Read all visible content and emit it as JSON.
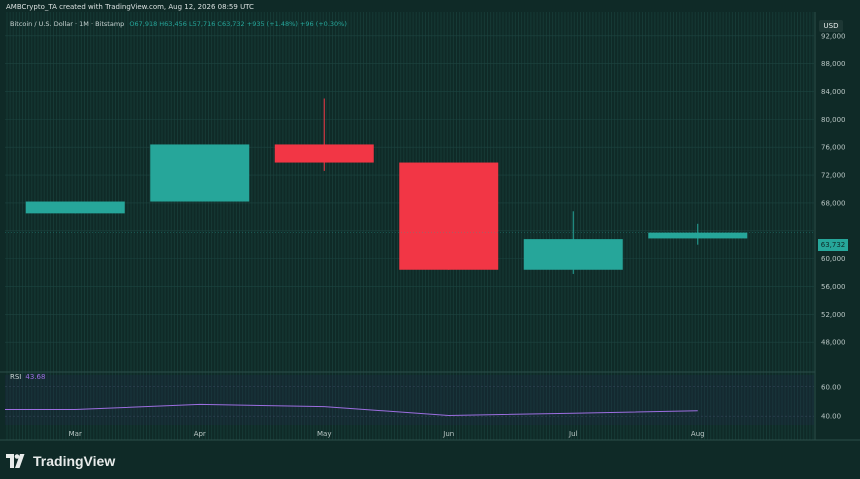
{
  "credit": "AMBCrypto_TA created with TradingView.com, Aug 12, 2026 08:59 UTC",
  "symbol": {
    "name": "Bitcoin / U.S. Dollar · 1M · Bitstamp",
    "ohlc": "O67,918 H63,456 L57,716 C63,732 +935 (+1.48%) +96 (+0.30%)"
  },
  "currency_badge": "USD",
  "last_price_label": "63,732",
  "rsi": {
    "label": "RSI",
    "value": "43.68"
  },
  "brand": "TradingView",
  "colors": {
    "bg": "#0f2a27",
    "up": "#26a69a",
    "down": "#f23645",
    "rsi": "#9c6ee0"
  },
  "chart_data": [
    {
      "type": "candlestick",
      "title": "Bitcoin / U.S. Dollar · 1M · Bitstamp",
      "categories": [
        "Mar",
        "Apr",
        "May",
        "Jun",
        "Jul",
        "Aug"
      ],
      "candles": [
        {
          "x": "Mar",
          "open": 66500,
          "high": 68200,
          "low": 66500,
          "close": 68200
        },
        {
          "x": "Apr",
          "open": 68200,
          "high": 76400,
          "low": 68200,
          "close": 76400
        },
        {
          "x": "May",
          "open": 76400,
          "high": 83000,
          "low": 72600,
          "close": 73800
        },
        {
          "x": "Jun",
          "open": 73800,
          "high": 73800,
          "low": 58400,
          "close": 58400
        },
        {
          "x": "Jul",
          "open": 58400,
          "high": 66800,
          "low": 57800,
          "close": 62800
        },
        {
          "x": "Aug",
          "open": 62900,
          "high": 65000,
          "low": 62000,
          "close": 63732
        }
      ],
      "y_ticks": [
        48000,
        52000,
        56000,
        60000,
        64000,
        68000,
        72000,
        76000,
        80000,
        84000,
        88000,
        92000
      ],
      "y_tick_labels": [
        "48,000",
        "52,000",
        "56,000",
        "60,000",
        "",
        "68,000",
        "72,000",
        "76,000",
        "80,000",
        "84,000",
        "88,000",
        "92,000"
      ],
      "ylim": [
        44000,
        96000
      ],
      "last_price": 63732,
      "grid": true
    },
    {
      "type": "line",
      "title": "RSI",
      "series": [
        {
          "name": "RSI",
          "x": [
            "Mar",
            "Apr",
            "May",
            "Jun",
            "Jul",
            "Aug"
          ],
          "values": [
            44.5,
            48.0,
            46.5,
            40.5,
            42.0,
            43.68
          ]
        }
      ],
      "y_ticks": [
        40,
        60
      ],
      "y_tick_labels": [
        "40.00",
        "60.00"
      ],
      "ylim": [
        34,
        68
      ]
    }
  ]
}
